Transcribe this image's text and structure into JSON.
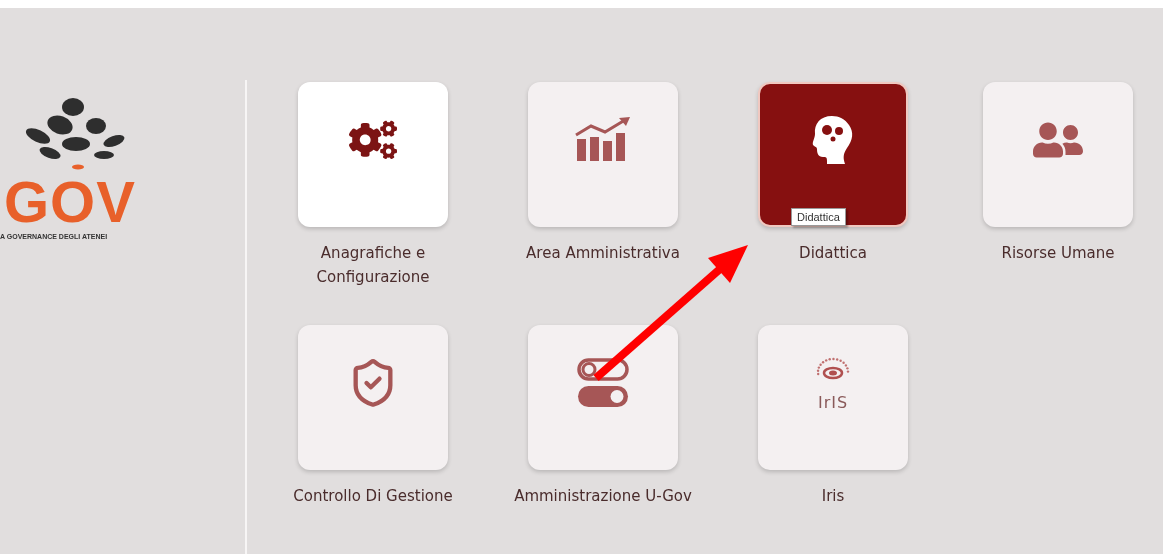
{
  "logo": {
    "wordmark": "GOV",
    "tagline": "A GOVERNANCE DEGLI ATENEI"
  },
  "tiles": [
    {
      "label": "Anagrafiche e Configurazione",
      "kind": "gears",
      "selected": false,
      "hovered": true
    },
    {
      "label": "Area Amministrativa",
      "kind": "chart",
      "selected": false,
      "hovered": false
    },
    {
      "label": "Didattica",
      "kind": "head",
      "selected": true,
      "hovered": false,
      "tooltip": "Didattica"
    },
    {
      "label": "Risorse Umane",
      "kind": "users",
      "selected": false,
      "hovered": false
    },
    {
      "label": "Controllo Di Gestione",
      "kind": "shield",
      "selected": false,
      "hovered": false
    },
    {
      "label": "Amministrazione U-Gov",
      "kind": "toggles",
      "selected": false,
      "hovered": false
    },
    {
      "label": "Iris",
      "kind": "iris",
      "selected": false,
      "hovered": false,
      "logo_text": "IrIS"
    }
  ],
  "annotation": {
    "kind": "arrow"
  }
}
